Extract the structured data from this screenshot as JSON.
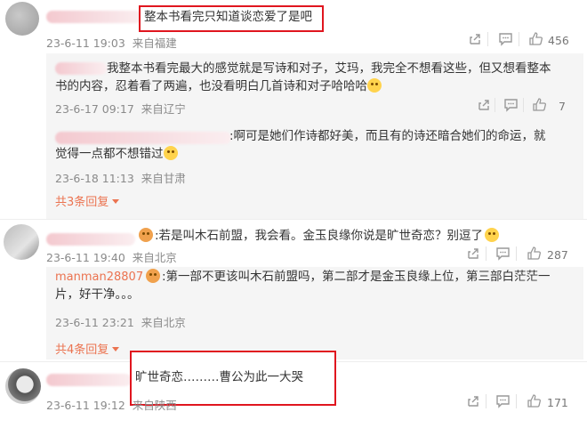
{
  "comments": [
    {
      "text": "整本书看完只知道谈恋爱了是吧",
      "time": "23-6-11 19:03",
      "location": "来自福建",
      "likes": "456",
      "replies": [
        {
          "text_line1": "我整本书看完最大的感觉就是写诗和对子，艾玛，我完全不想看这些，但又想看整本",
          "text_line2": "书的内容，忍着看了两遍，也没看明白几首诗和对子哈哈哈",
          "time": "23-6-17 09:17",
          "location": "来自辽宁",
          "likes": "7"
        },
        {
          "text_line1": ":啊可是她们作诗都好美，而且有的诗还暗合她们的命运，就",
          "text_line2": "觉得一点都不想错过",
          "time": "23-6-18 11:13",
          "location": "来自甘肃"
        }
      ],
      "replies_link": "共3条回复"
    },
    {
      "text": ":若是叫木石前盟，我会看。金玉良缘你说是旷世奇恋？别逗了",
      "time": "23-6-11 19:40",
      "location": "来自北京",
      "likes": "287",
      "replies": [
        {
          "username": "manman28807",
          "text_line1": ":第一部不更该叫木石前盟吗，第二部才是金玉良缘上位，第三部白茫茫一",
          "text_line2": "片，好干净。。。",
          "time": "23-6-11 23:21",
          "location": "来自北京"
        }
      ],
      "replies_link": "共4条回复"
    },
    {
      "text": "旷世奇恋………曹公为此一大哭",
      "time": "23-6-11 19:12",
      "location": "来自陕西",
      "likes": "171"
    }
  ],
  "colors": {
    "highlight_border": "#e0161f",
    "link": "#eb7350",
    "meta": "#8a8a8a"
  },
  "icons": [
    "share-icon",
    "comment-icon",
    "like-icon",
    "caret-down-icon",
    "emoji-icon"
  ]
}
